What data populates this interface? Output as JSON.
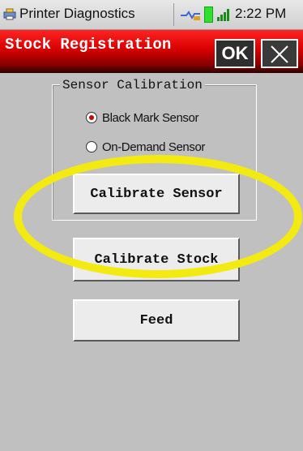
{
  "status_bar": {
    "app_name": "Printer Diagnostics",
    "time": "2:22 PM",
    "icons": [
      "printer-app-icon",
      "connection-icon",
      "battery-icon",
      "signal-icon"
    ]
  },
  "title_bar": {
    "title": "Stock Registration",
    "ok_label": "OK",
    "close_icon": "close-icon"
  },
  "sensor_calibration": {
    "legend": "Sensor Calibration",
    "options": [
      {
        "label": "Black Mark Sensor",
        "selected": true
      },
      {
        "label": "On-Demand Sensor",
        "selected": false
      }
    ],
    "calibrate_sensor_label": "Calibrate Sensor"
  },
  "actions": {
    "calibrate_stock_label": "Calibrate Stock",
    "feed_label": "Feed"
  },
  "colors": {
    "title_red": "#d80000",
    "highlight_yellow": "#f3ea12",
    "background": "#c0c0c0"
  }
}
